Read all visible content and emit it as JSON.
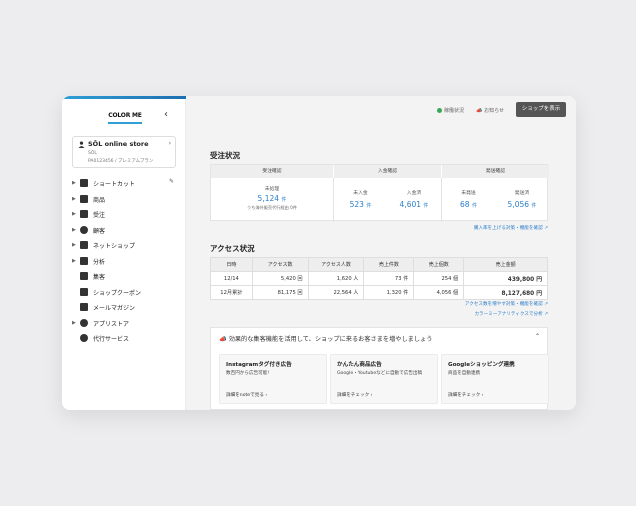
{
  "brand": {
    "logo_text": "COLOR ME",
    "accent": "#2f9fd6",
    "bar_start": "#2f9fd6",
    "bar_end": "#1c6fb0"
  },
  "store": {
    "name": "SŌL online store",
    "sub1": "SŌL",
    "sub2": "PA0123456 / プレミアムプラン"
  },
  "nav": [
    {
      "label": "ショートカット",
      "icon": "bookmark-icon",
      "arrow": true,
      "edit": true
    },
    {
      "label": "商品",
      "icon": "product-box-icon",
      "arrow": true
    },
    {
      "label": "受注",
      "icon": "order-icon",
      "arrow": true
    },
    {
      "label": "顧客",
      "icon": "customers-icon",
      "arrow": true
    },
    {
      "label": "ネットショップ",
      "icon": "shop-icon",
      "arrow": true
    },
    {
      "label": "分析",
      "icon": "bar-chart-icon",
      "arrow": true
    },
    {
      "label": "集客",
      "icon": "megaphone-icon",
      "arrow": false
    },
    {
      "label": "ショップクーポン",
      "icon": "coupon-icon",
      "arrow": false
    },
    {
      "label": "メールマガジン",
      "icon": "mail-icon",
      "arrow": false
    },
    {
      "label": "アプリストア",
      "icon": "plus-circle-icon",
      "arrow": true
    },
    {
      "label": "代行サービス",
      "icon": "refresh-circle-icon",
      "arrow": false
    }
  ],
  "topbar": {
    "status": "稼働状況",
    "notice": "お知らせ",
    "shop_button": "ショップを表示"
  },
  "orders": {
    "title": "受注状況",
    "groups": [
      "受注確認",
      "入金確認",
      "発送確認"
    ],
    "cells": [
      {
        "label": "未処理",
        "value": "5,124",
        "unit": "件",
        "note": "うち海外販売代行経由 0件"
      },
      {
        "label": "未入金",
        "value": "523",
        "unit": "件"
      },
      {
        "label": "入金済",
        "value": "4,601",
        "unit": "件"
      },
      {
        "label": "未発送",
        "value": "68",
        "unit": "件"
      },
      {
        "label": "発送済",
        "value": "5,056",
        "unit": "件"
      }
    ],
    "link": "購入率を上げる対策・機能を確認"
  },
  "access": {
    "title": "アクセス状況",
    "headers": [
      "日時",
      "アクセス数",
      "アクセス人数",
      "売上件数",
      "売上個数",
      "売上金額"
    ],
    "rows": [
      [
        "12/14",
        "5,420 回",
        "1,620 人",
        "73 件",
        "254 個",
        "439,800 円"
      ],
      [
        "12月累計",
        "81,175 回",
        "22,564 人",
        "1,320 件",
        "4,056 個",
        "8,127,680 円"
      ]
    ],
    "link1": "アクセス数を増やす対策・機能を確認",
    "link2": "カラーミーアナリティクスで分析"
  },
  "promo": {
    "heading": "効果的な集客機能を活用して、ショップに来るお客さまを増やしましょう",
    "cards": [
      {
        "title": "Instagramタグ付き広告",
        "desc": "数百円から広告可能!",
        "link": "詳細をnoteで見る"
      },
      {
        "title": "かんたん商品広告",
        "desc": "Google・Youtubeなどに自動で広告出稿",
        "link": "詳細をチェック"
      },
      {
        "title": "Googleショッピング連携",
        "desc": "商品を自動連携",
        "link": "詳細をチェック"
      }
    ]
  }
}
